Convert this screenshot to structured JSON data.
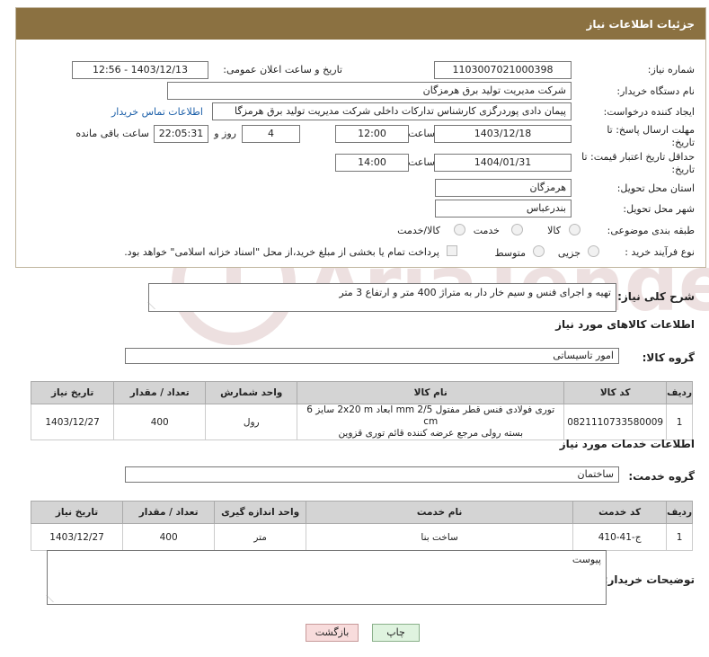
{
  "header": {
    "title": "جزئیات اطلاعات نیاز"
  },
  "form": {
    "need_number_label": "شماره نیاز:",
    "need_number": "1103007021000398",
    "announce_label": "تاریخ و ساعت اعلان عمومی:",
    "announce_value": "1403/12/13 - 12:56",
    "buyer_org_label": "نام دستگاه خریدار:",
    "buyer_org": "شرکت مدیریت تولید برق هرمزگان",
    "creator_label": "ایجاد کننده درخواست:",
    "creator": "پیمان دادی پوردرگزی کارشناس تدارکات داخلی شرکت مدیریت تولید برق هرمزگا",
    "contact_link": "اطلاعات تماس خریدار",
    "deadline_label_1": "مهلت ارسال پاسخ: تا",
    "deadline_label_2": "تاریخ:",
    "deadline_date": "1403/12/18",
    "time_label": "ساعت",
    "deadline_time": "12:00",
    "days": "4",
    "days_label": "روز و",
    "remaining": "22:05:31",
    "remaining_label": "ساعت باقی مانده",
    "validity_label_1": "حداقل تاریخ اعتبار قیمت: تا",
    "validity_label_2": "تاریخ:",
    "validity_date": "1404/01/31",
    "validity_time": "14:00",
    "province_label": "استان محل تحویل:",
    "province": "هرمزگان",
    "city_label": "شهر محل تحویل:",
    "city": "بندرعباس",
    "category_label": "طبقه بندی موضوعی:",
    "category_options": [
      "کالا",
      "خدمت",
      "کالا/خدمت"
    ],
    "process_label": "نوع فرآیند خرید :",
    "process_options": [
      "جزیی",
      "متوسط"
    ],
    "payment_note": "پرداخت تمام یا بخشی از مبلغ خرید،از محل \"اسناد خزانه اسلامی\" خواهد بود."
  },
  "summary": {
    "label": "شرح کلی نیاز:",
    "text": "تهیه و اجرای فنس و سیم خار دار به متراژ 400 متر و ارتفاع 3 متر"
  },
  "goods": {
    "section_title": "اطلاعات کالاهای مورد نیاز",
    "group_label": "گروه کالا:",
    "group_value": "امور تاسیساتی",
    "headers": [
      "ردیف",
      "کد کالا",
      "نام کالا",
      "واحد شمارش",
      "تعداد / مقدار",
      "تاریخ نیاز"
    ],
    "rows": [
      {
        "row": "1",
        "code": "0821110733580009",
        "name_line1": "توری فولادی فنس قطر مفتول mm 2/5 ابعاد 2x20 m سایز 6 cm",
        "name_line2": "بسته رولی مرجع عرضه کننده قائم توری قزوین",
        "unit": "رول",
        "qty": "400",
        "date": "1403/12/27"
      }
    ]
  },
  "services": {
    "section_title": "اطلاعات خدمات مورد نیاز",
    "group_label": "گروه خدمت:",
    "group_value": "ساختمان",
    "headers": [
      "ردیف",
      "کد خدمت",
      "نام خدمت",
      "واحد اندازه گیری",
      "تعداد / مقدار",
      "تاریخ نیاز"
    ],
    "rows": [
      {
        "row": "1",
        "code": "ج-41-410",
        "name": "ساخت بنا",
        "unit": "متر",
        "qty": "400",
        "date": "1403/12/27"
      }
    ]
  },
  "buyer_notes": {
    "label": "توضیحات خریدار:",
    "text": "پیوست"
  },
  "buttons": {
    "print": "چاپ",
    "back": "بازگشت"
  },
  "watermark": {
    "text": "AriaTender.net"
  }
}
